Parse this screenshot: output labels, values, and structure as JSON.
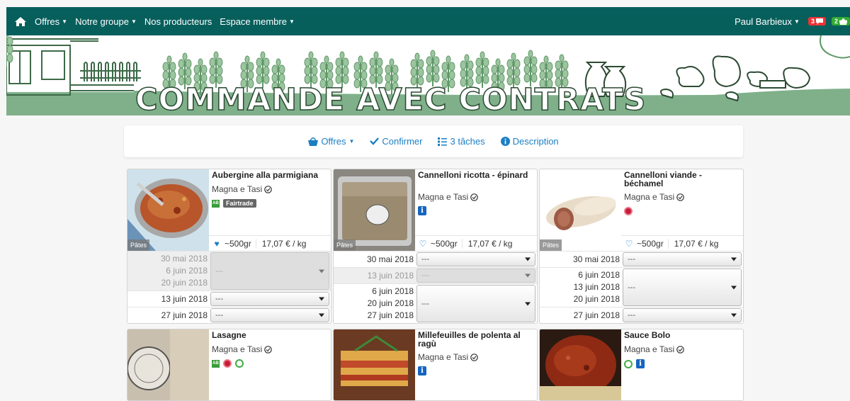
{
  "navbar": {
    "menu": [
      {
        "label": "Offres",
        "has_caret": true
      },
      {
        "label": "Notre groupe",
        "has_caret": true
      },
      {
        "label": "Nos producteurs",
        "has_caret": false
      },
      {
        "label": "Espace membre",
        "has_caret": true
      }
    ],
    "user": "Paul Barbieux",
    "messages_badge": "3",
    "basket_badge": "2"
  },
  "banner": {
    "title": "COMMANDE AVEC CONTRATS"
  },
  "toolbar": {
    "offers": "Offres",
    "confirm": "Confirmer",
    "tasks": "3 tâches",
    "description": "Description"
  },
  "products": [
    {
      "title": "Aubergine alla parmigiana",
      "producer": "Magna e Tasi",
      "labels": [
        "bio",
        "Fairtrade"
      ],
      "category": "Pâtes",
      "favorite": true,
      "weight": "~500gr",
      "price": "17,07 € / kg",
      "date_groups": [
        {
          "dates": [
            "30 mai 2018",
            "6 juin 2018",
            "20 juin 2018"
          ],
          "value": "---",
          "disabled": true
        },
        {
          "dates": [
            "13 juin 2018"
          ],
          "value": "---",
          "disabled": false
        },
        {
          "dates": [
            "27 juin 2018"
          ],
          "value": "---",
          "disabled": false
        }
      ]
    },
    {
      "title": "Cannelloni ricotta - épinard",
      "producer": "Magna e Tasi",
      "labels": [
        "info"
      ],
      "category": "Pâtes",
      "favorite": false,
      "weight": "~500gr",
      "price": "17,07 € / kg",
      "date_groups": [
        {
          "dates": [
            "30 mai 2018"
          ],
          "value": "---",
          "disabled": false
        },
        {
          "dates": [
            "13 juin 2018"
          ],
          "value": "---",
          "disabled": true
        },
        {
          "dates": [
            "6 juin 2018",
            "20 juin 2018",
            "27 juin 2018"
          ],
          "value": "---",
          "disabled": false
        }
      ]
    },
    {
      "title": "Cannelloni viande - béchamel",
      "producer": "Magna e Tasi",
      "labels": [
        "red-circle"
      ],
      "category": "Pâtes",
      "favorite": false,
      "weight": "~500gr",
      "price": "17,07 € / kg",
      "date_groups": [
        {
          "dates": [
            "30 mai 2018"
          ],
          "value": "---",
          "disabled": false
        },
        {
          "dates": [
            "6 juin 2018",
            "13 juin 2018",
            "20 juin 2018"
          ],
          "value": "---",
          "disabled": false
        },
        {
          "dates": [
            "27 juin 2018"
          ],
          "value": "---",
          "disabled": false
        }
      ]
    },
    {
      "title": "Lasagne",
      "producer": "Magna e Tasi",
      "labels": [
        "bio",
        "red-circle",
        "green-circle"
      ]
    },
    {
      "title": "Millefeuilles de polenta al ragù",
      "producer": "Magna e Tasi",
      "labels": [
        "info"
      ]
    },
    {
      "title": "Sauce Bolo",
      "producer": "Magna e Tasi",
      "labels": [
        "green-circle",
        "info"
      ]
    }
  ],
  "colors": {
    "navbar": "#075f5c",
    "link": "#1b7fc4",
    "banner_green": "#7fb08a",
    "info_blue": "#1565c0"
  }
}
